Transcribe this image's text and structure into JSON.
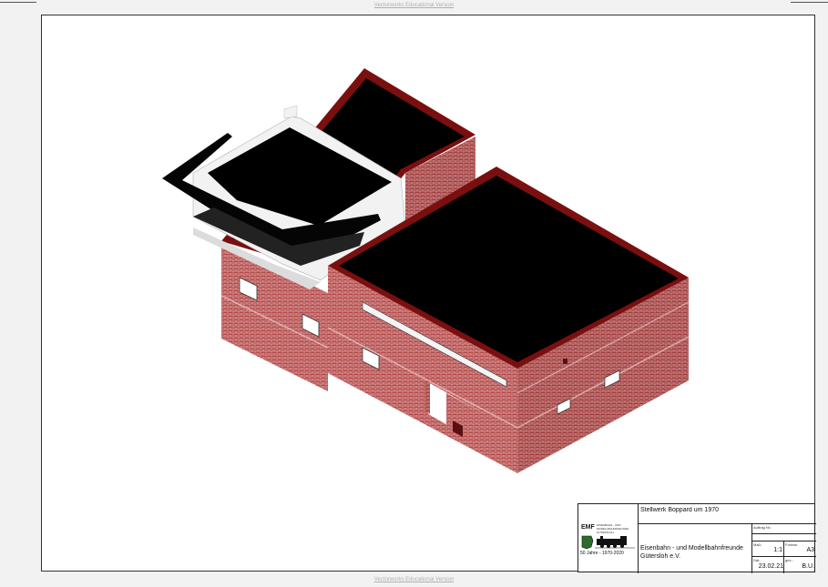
{
  "watermark": {
    "text": "Vectorworks Educational Version"
  },
  "title_block": {
    "project_title": "Stellwerk Boppard um 1970",
    "organization": "Eisenbahn - und Modellbahnfreunde Gütersloh e.V.",
    "logo_abbrev": "EMF",
    "logo_subtext_1": "EISENBAHN - UND",
    "logo_subtext_2": "MODELLBAHNFREUNDE",
    "logo_subtext_3": "GÜTERSLOH",
    "anniversary": "50 Jahre   -   1970-2020",
    "order_label": "Auftrag Nr.:",
    "scale_label": "Maß:",
    "scale_value": "1:1",
    "format_label": "Format:",
    "format_value": "A3",
    "date_label": "Dat.:",
    "date_value": "23.02.21",
    "author_label": "gez.:",
    "author_value": "B.U."
  },
  "colors": {
    "brick": "#b24545",
    "brick_dark": "#8e2f2f",
    "roof": "#000000",
    "parapet": "#7a0f0f",
    "canopy_white": "#f4f4f4"
  }
}
